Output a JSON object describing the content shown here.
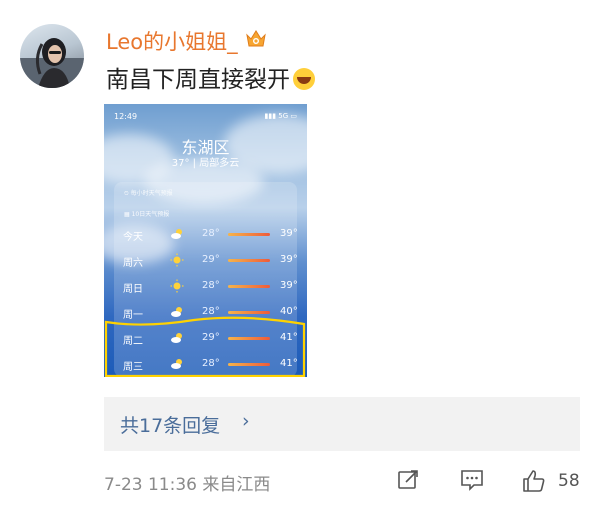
{
  "comment": {
    "username": "Leo的小姐姐_",
    "text": "南昌下周直接裂开",
    "emoji_icon": "laughing-tears-emoji",
    "vip_icon": "vip-crown-icon"
  },
  "photo": {
    "status_time": "12:49",
    "status_right": "5G",
    "city": "东湖区",
    "current": "37° | 局部多云",
    "hourly_label": "每小时天气预报",
    "ten_day_label": "10日天气预报",
    "forecast": [
      {
        "day": "今天",
        "icon": "partly-cloudy",
        "low": "28°",
        "high": "39°"
      },
      {
        "day": "周六",
        "icon": "sunny",
        "low": "29°",
        "high": "39°"
      },
      {
        "day": "周日",
        "icon": "sunny",
        "low": "28°",
        "high": "39°"
      },
      {
        "day": "周一",
        "icon": "partly-cloudy",
        "low": "28°",
        "high": "40°"
      },
      {
        "day": "周二",
        "icon": "partly-cloudy",
        "low": "29°",
        "high": "41°"
      },
      {
        "day": "周三",
        "icon": "partly-cloudy",
        "low": "28°",
        "high": "41°"
      }
    ]
  },
  "replies": {
    "label": "共17条回复"
  },
  "meta": {
    "time": "7-23 11:36",
    "location": "来自江西"
  },
  "actions": {
    "like_count": "58",
    "share_icon": "share-icon",
    "comment_icon": "comment-icon",
    "like_icon": "thumbs-up-icon"
  },
  "colors": {
    "username": "#e8772e",
    "reply_link": "#4a6d9a",
    "highlight": "#ffd200"
  }
}
